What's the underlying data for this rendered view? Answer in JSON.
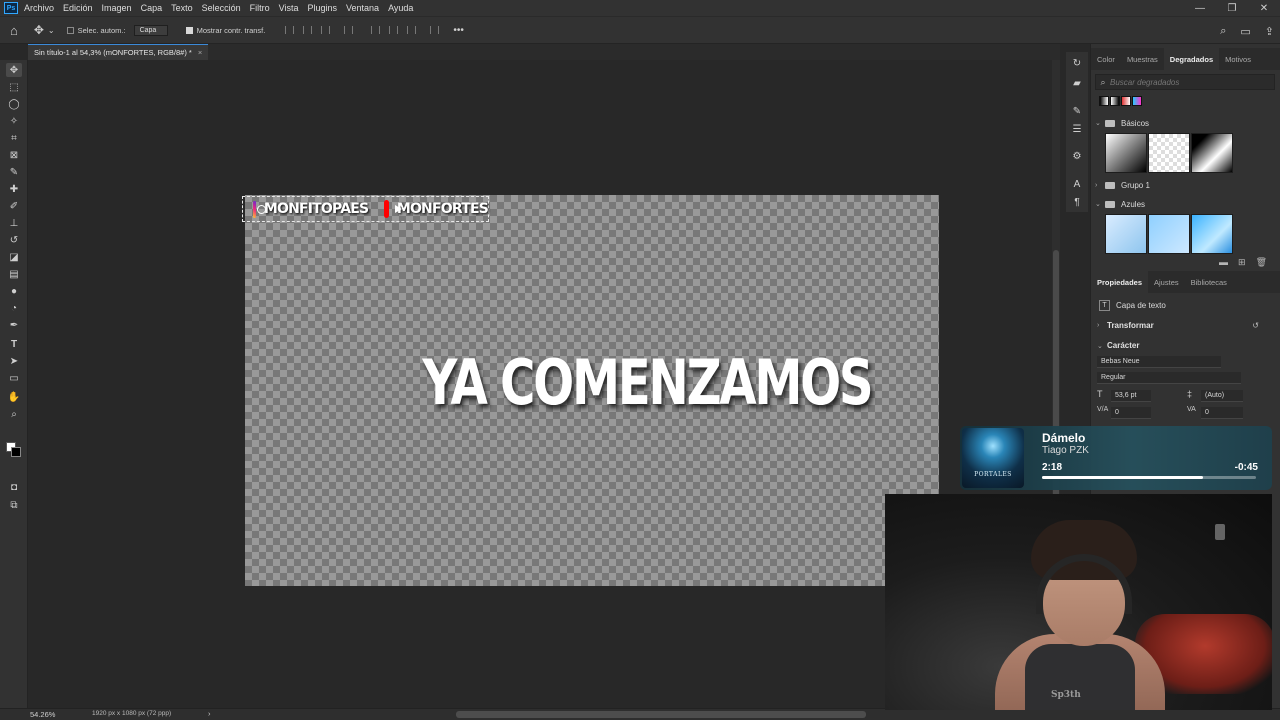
{
  "app": {
    "logo": "Ps"
  },
  "menu": [
    "Archivo",
    "Edición",
    "Imagen",
    "Capa",
    "Texto",
    "Selección",
    "Filtro",
    "Vista",
    "Plugins",
    "Ventana",
    "Ayuda"
  ],
  "options": {
    "auto_select_label": "Selec. autom.:",
    "layer_select": "Capa",
    "show_transform_label": "Mostrar contr. transf.",
    "more": "•••"
  },
  "document": {
    "tab_title": "Sin título-1 al 54,3% (mONFORTES, RGB/8#) *",
    "tab_close": "×"
  },
  "canvas": {
    "instagram_handle": "MONFITOPAES",
    "youtube_handle": "MONFORTES",
    "headline": "YA COMENZAMOS"
  },
  "status": {
    "zoom": "54.26%",
    "doc_size": "1920 px x 1080 px (72 ppp)",
    "arrow": "›"
  },
  "gradients_panel": {
    "tabs": [
      "Color",
      "Muestras",
      "Degradados",
      "Motivos"
    ],
    "active_tab": "Degradados",
    "search_placeholder": "Buscar degradados",
    "folders": [
      "Básicos",
      "Grupo 1",
      "Azules"
    ]
  },
  "properties_panel": {
    "tabs": [
      "Propiedades",
      "Ajustes",
      "Bibliotecas"
    ],
    "active_tab": "Propiedades",
    "layer_type": "Capa de texto",
    "transform_section": "Transformar",
    "character_section": "Carácter",
    "font_family": "Bebas Neue",
    "font_style": "Regular",
    "font_size": "53,6 pt",
    "leading": "(Auto)",
    "kerning": "0",
    "tracking": "0"
  },
  "music": {
    "title": "Dámelo",
    "artist": "Tiago PZK",
    "elapsed": "2:18",
    "remaining": "-0:45",
    "progress": 0.754,
    "album_text": "PORTALES"
  },
  "webcam": {
    "shirt_text": "Sp3th"
  },
  "colors": {
    "accent": "#3b8ad9",
    "panel": "#323232",
    "workspace": "#282828"
  }
}
